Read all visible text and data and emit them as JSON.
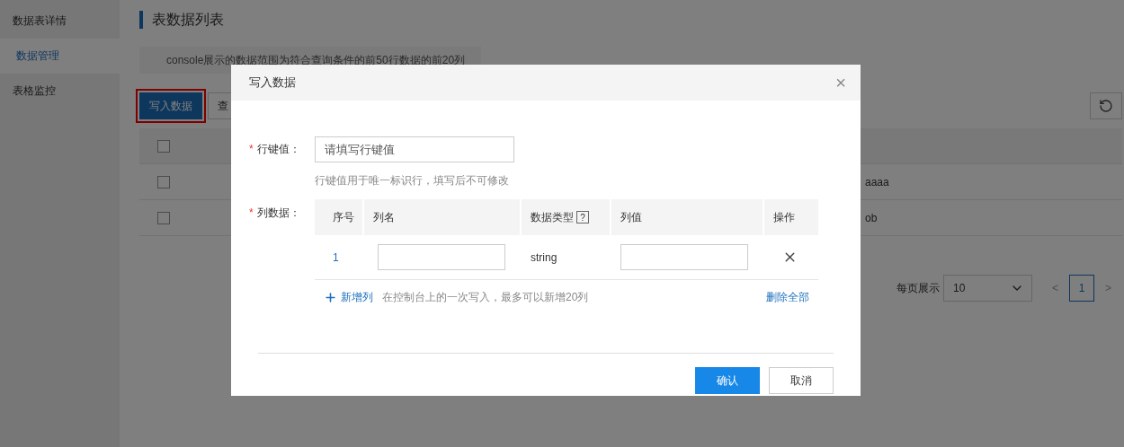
{
  "sidebar": {
    "items": [
      {
        "label": "数据表详情",
        "selected": false
      },
      {
        "label": "数据管理",
        "selected": true
      },
      {
        "label": "表格监控",
        "selected": false
      }
    ]
  },
  "page": {
    "title": "表数据列表",
    "notice": "console展示的数据范围为符合查询条件的前50行数据的前20列",
    "toolbar": [
      {
        "label": "写入数据",
        "kind": "primary"
      },
      {
        "label": "查",
        "kind": "default"
      }
    ]
  },
  "table": {
    "rows": [
      {
        "checked": false,
        "column_3": "aaaa"
      },
      {
        "checked": false,
        "column_3": "ob"
      }
    ],
    "header_checked": false
  },
  "pagination": {
    "page_size_label": "每页展示",
    "page_size": "10",
    "prev": "<",
    "next": ">",
    "pages": [
      {
        "label": "1",
        "selected": true
      }
    ]
  },
  "dialog": {
    "title": "写入数据",
    "close": "×",
    "row_key": {
      "required_mark": "*",
      "label": "行键值：",
      "placeholder": "请填写行键值",
      "hint": "行键值用于唯一标识行，填写后不可修改"
    },
    "columns": {
      "required_mark": "*",
      "label": "列数据：",
      "headers": [
        "序号",
        "列名",
        "数据类型",
        "列值",
        "操作"
      ],
      "type_help": "?",
      "rows": [
        {
          "index": "1",
          "type": "string"
        }
      ],
      "add_label": "新增列",
      "add_hint": "在控制台上的一次写入，最多可以新增20列",
      "delete_all": "删除全部"
    },
    "buttons": [
      {
        "label": "确认",
        "kind": "primary"
      },
      {
        "label": "取消",
        "kind": "default"
      }
    ]
  }
}
